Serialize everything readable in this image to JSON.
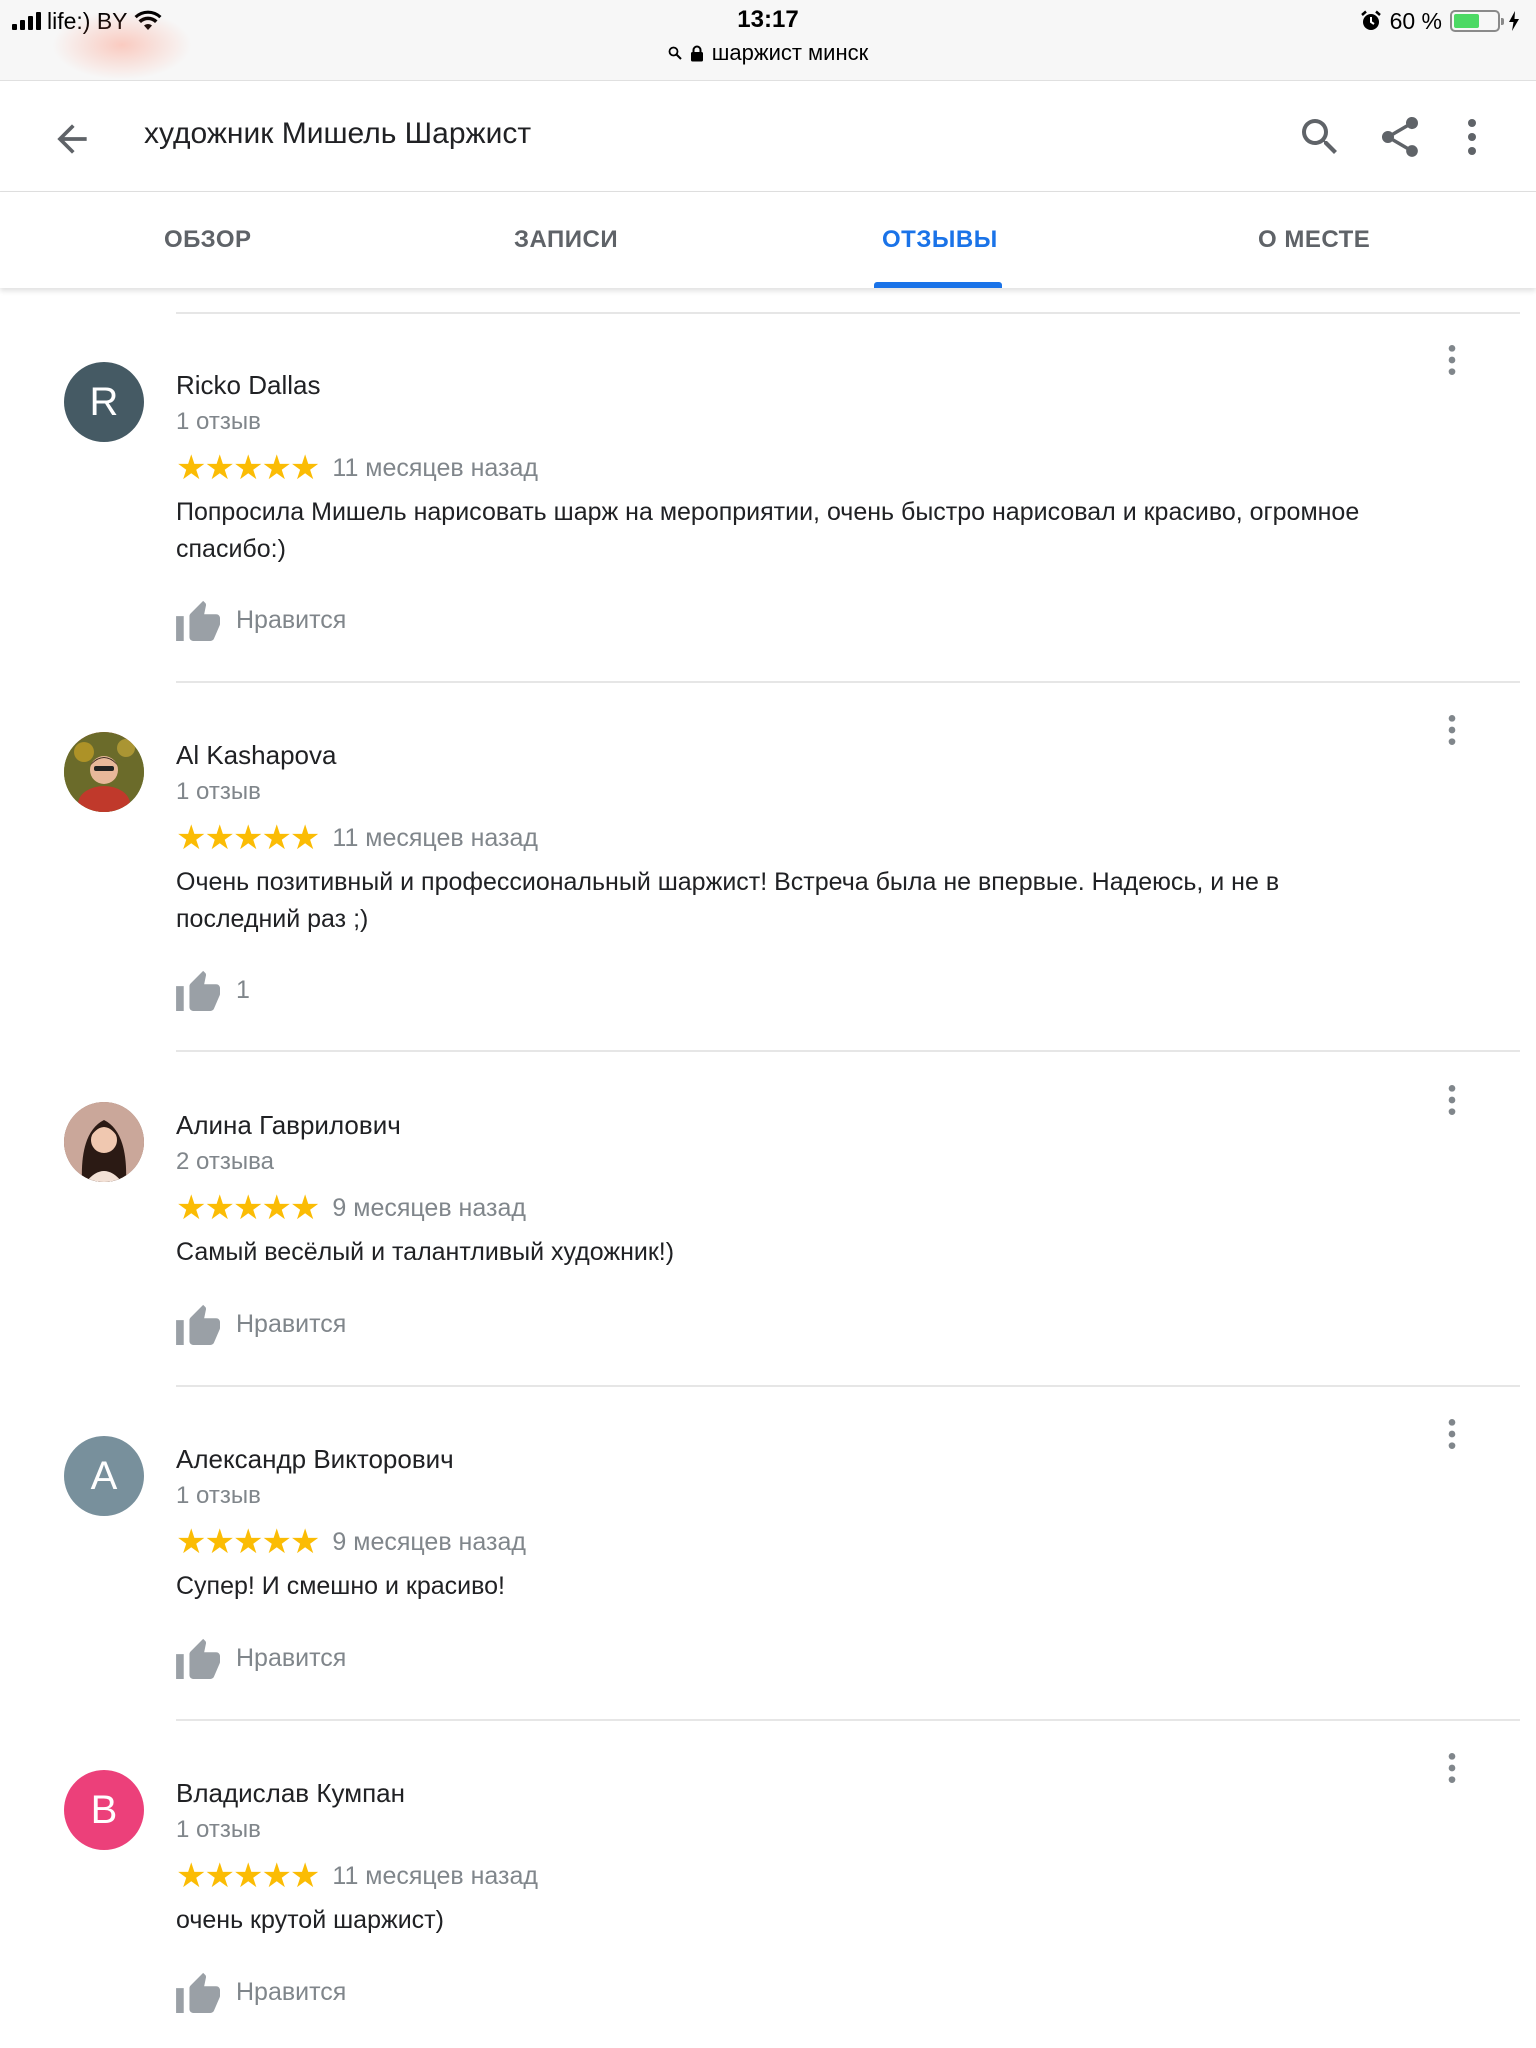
{
  "status_bar": {
    "carrier": "life:) BY",
    "time": "13:17",
    "url": "шаржист минск",
    "battery": "60 %",
    "battery_level": 0.6
  },
  "app_bar": {
    "title": "художник Мишель Шаржист",
    "icons": [
      "arrow-back-icon",
      "search-icon",
      "share-icon",
      "more-vert-icon"
    ]
  },
  "tabs": [
    {
      "label": "ОБЗОР",
      "active": false
    },
    {
      "label": "ЗАПИСИ",
      "active": false
    },
    {
      "label": "ОТЗЫВЫ",
      "active": true
    },
    {
      "label": "О МЕСТЕ",
      "active": false
    }
  ],
  "colors": {
    "accent": "#1a73e8",
    "star": "#fbbc04",
    "secondary_text": "#80868b"
  },
  "reviews": [
    {
      "avatar_letter": "R",
      "avatar_color": "#455a64",
      "author": "Ricko Dallas",
      "count": "1 отзыв",
      "rating": 5,
      "stars": "★★★★★",
      "date": "11 месяцев назад",
      "text": "Попросила Мишель нарисовать шарж на мероприятии, очень быстро нарисовал и красиво, огромное спасибо:)",
      "like": "Нравится"
    },
    {
      "avatar_letter": "",
      "avatar_color": "#6b5a3a",
      "author": "Al Kashapova",
      "count": "1 отзыв",
      "rating": 5,
      "stars": "★★★★★",
      "date": "11 месяцев назад",
      "text": "Очень позитивный и профессиональный шаржист! Встреча была не впервые. Надеюсь, и не в последний раз ;)",
      "like": "1"
    },
    {
      "avatar_letter": "",
      "avatar_color": "#8a5a4a",
      "author": "Алина Гаврилович",
      "count": "2 отзыва",
      "rating": 5,
      "stars": "★★★★★",
      "date": "9 месяцев назад",
      "text": "Самый весёлый и талантливый художник!)",
      "like": "Нравится"
    },
    {
      "avatar_letter": "A",
      "avatar_color": "#78909c",
      "author": "Александр Викторович",
      "count": "1 отзыв",
      "rating": 5,
      "stars": "★★★★★",
      "date": "9 месяцев назад",
      "text": "Супер! И смешно и красиво!",
      "like": "Нравится"
    },
    {
      "avatar_letter": "B",
      "avatar_color": "#ec407a",
      "author": "Владислав Кумпан",
      "count": "1 отзыв",
      "rating": 5,
      "stars": "★★★★★",
      "date": "11 месяцев назад",
      "text": "очень крутой шаржист)",
      "like": "Нравится"
    }
  ]
}
